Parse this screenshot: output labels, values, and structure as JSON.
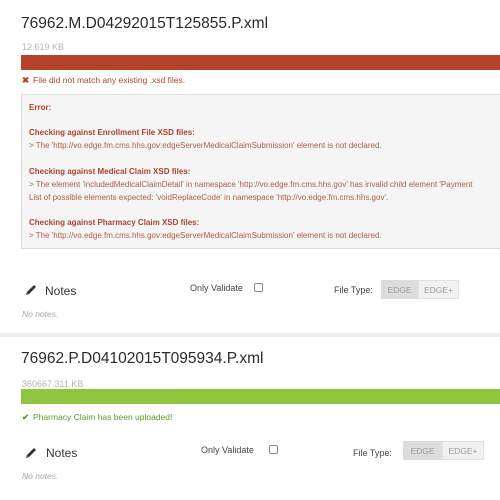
{
  "colors": {
    "error_bar": "#b5432a",
    "success_bar": "#8cc63f",
    "error_text": "#b5432a",
    "success_text": "#5a9b2a"
  },
  "files": [
    {
      "name": "76962.M.D04292015T125855.P.xml",
      "size": "12.619 KB",
      "progress_percent": 100,
      "status_icon": "x-icon",
      "status_glyph": "✖",
      "status_message": "File did not match any existing .xsd files.",
      "error": {
        "title": "Error:",
        "sections": [
          {
            "heading": "Checking against Enrollment File XSD files:",
            "lines": [
              "> The 'http://vo.edge.fm.cms.hhs.gov:edgeServerMedicalClaimSubmission' element is not declared."
            ]
          },
          {
            "heading": "Checking against Medical Claim XSD files:",
            "lines": [
              "> The element 'includedMedicalClaimDetail' in namespace 'http://vo.edge.fm.cms.hhs.gov' has invalid child element 'Payment",
              "List of possible elements expected: 'voidReplaceCode' in namespace 'http://vo.edge.fm.cms.hhs.gov'."
            ]
          },
          {
            "heading": "Checking against Pharmacy Claim XSD files:",
            "lines": [
              "> The 'http://vo.edge.fm.cms.hhs.gov:edgeServerMedicalClaimSubmission' element is not declared."
            ]
          }
        ]
      },
      "notes_label": "Notes",
      "notes_empty": "No notes.",
      "only_validate_label": "Only Validate",
      "only_validate_checked": false,
      "file_type_label": "File Type:",
      "file_type_options": [
        "EDGE",
        "EDGE+"
      ]
    },
    {
      "name": "76962.P.D04102015T095934.P.xml",
      "size": "360667.311 KB",
      "progress_percent": 100,
      "status_icon": "check-icon",
      "status_glyph": "✔",
      "status_message": "Pharmacy Claim has been uploaded!",
      "notes_label": "Notes",
      "notes_empty": "No notes.",
      "only_validate_label": "Only Validate",
      "only_validate_checked": false,
      "file_type_label": "File Type:",
      "file_type_options": [
        "EDGE",
        "EDGE+"
      ]
    }
  ]
}
